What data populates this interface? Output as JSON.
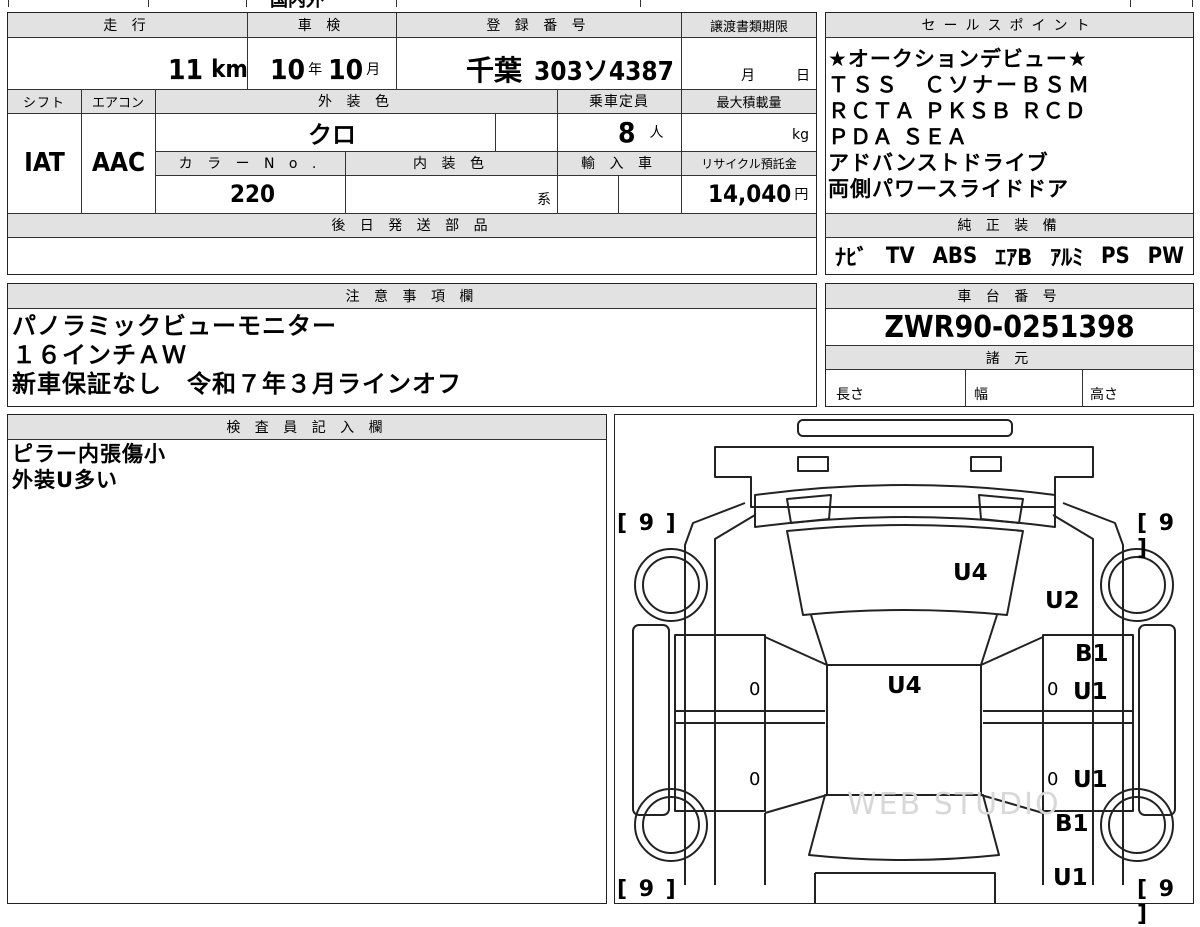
{
  "top_row": {
    "cut_text": "国内外"
  },
  "headers": {
    "mileage": "走 行",
    "inspection": "車 検",
    "registration": "登 録 番 号",
    "transfer_deadline": "譲渡書類期限",
    "shift": "シフト",
    "aircon": "エアコン",
    "exterior_color": "外 装 色",
    "capacity": "乗車定員",
    "max_load": "最大積載量",
    "color_no": "カ ラ ー N o .",
    "interior_color": "内 装 色",
    "import": "輸 入 車",
    "recycle": "リサイクル預託金",
    "later_parts": "後 日 発 送 部 品",
    "sales_points": "セールスポイント",
    "genuine_equipment": "純 正 装 備",
    "notes": "注 意 事 項 欄",
    "chassis": "車 台 番 号",
    "specs": "諸 元",
    "inspector": "検 査 員 記 入 欄"
  },
  "values": {
    "mileage": "11",
    "mileage_unit": "km",
    "inspection_year": "10",
    "year_unit": "年",
    "inspection_month": "10",
    "month_unit": "月",
    "registration_place": "千葉",
    "registration_number": "303ソ4387",
    "deadline_month_unit": "月",
    "deadline_day_unit": "日",
    "shift": "IAT",
    "aircon": "AAC",
    "exterior_color": "クロ",
    "capacity": "8",
    "capacity_unit": "人",
    "max_load_unit": "kg",
    "color_no": "220",
    "interior_color_unit": "系",
    "recycle_fee": "14,040",
    "recycle_unit": "円",
    "chassis_number": "ZWR90-0251398",
    "length_label": "長さ",
    "width_label": "幅",
    "height_label": "高さ"
  },
  "sales_points": [
    "★オークションデビュー★",
    "ＴＳＳ　ＣソナーＢＳＭ",
    "ＲＣＴＡ ＰＫＳＢ ＲＣＤ",
    "ＰＤＡ ＳＥＡ",
    "アドバンストドライブ",
    "両側パワースライドドア"
  ],
  "genuine_equipment": [
    "ﾅﾋﾞ",
    "TV",
    "ABS",
    "ｴｱB",
    "ｱﾙﾐ",
    "PS",
    "PW"
  ],
  "notes": [
    "パノラミックビューモニター",
    "１６インチＡＷ",
    "新車保証なし　令和７年３月ラインオフ"
  ],
  "inspector_notes": [
    "ピラー内張傷小",
    "外装U多い"
  ],
  "diagram": {
    "tire_depth_labels": [
      "[ 9 ]",
      "[ 9 ]",
      "[ 9 ]",
      "[ 9 ]"
    ],
    "damage_marks": [
      "U4",
      "U2",
      "U4",
      "B1",
      "U1",
      "U1",
      "B1",
      "U1"
    ],
    "zero_marks": [
      "0",
      "0",
      "0",
      "0"
    ],
    "watermark": "WEB STUDIO"
  }
}
